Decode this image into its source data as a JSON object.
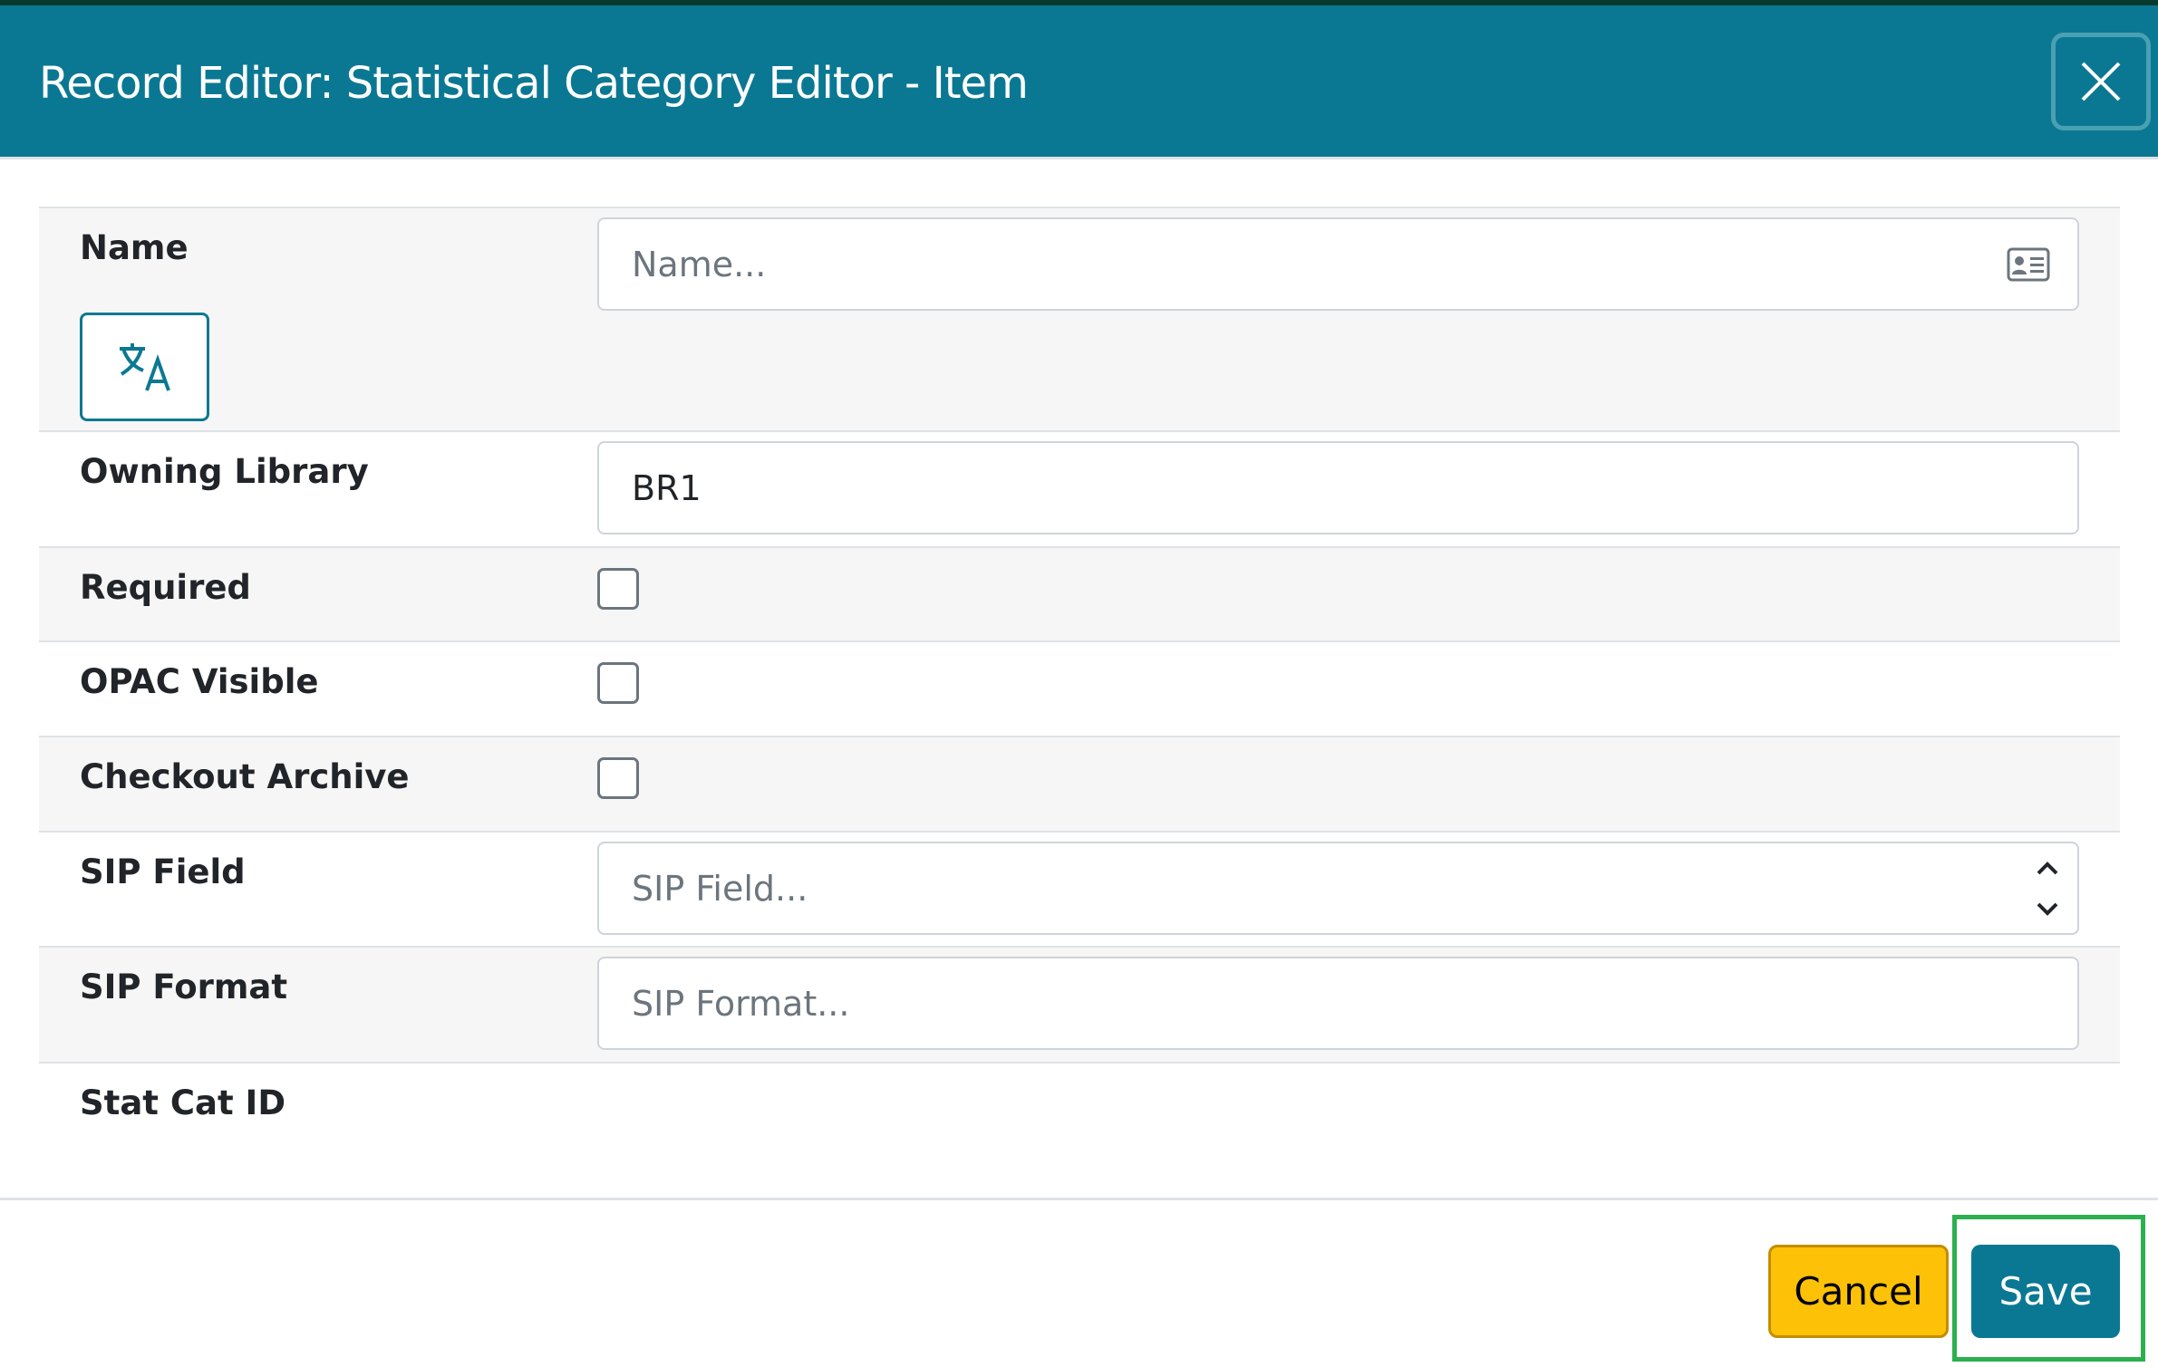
{
  "dialog": {
    "title": "Record Editor: Statistical Category Editor - Item"
  },
  "fields": {
    "name": {
      "label": "Name",
      "placeholder": "Name...",
      "value": ""
    },
    "owning_library": {
      "label": "Owning Library",
      "value": "BR1"
    },
    "required": {
      "label": "Required",
      "checked": false
    },
    "opac_visible": {
      "label": "OPAC Visible",
      "checked": false
    },
    "checkout_archive": {
      "label": "Checkout Archive",
      "checked": false
    },
    "sip_field": {
      "label": "SIP Field",
      "placeholder": "SIP Field..."
    },
    "sip_format": {
      "label": "SIP Format",
      "placeholder": "SIP Format..."
    },
    "stat_cat_id": {
      "label": "Stat Cat ID",
      "value": ""
    }
  },
  "footer": {
    "cancel_label": "Cancel",
    "save_label": "Save"
  },
  "colors": {
    "header": "#0b7893",
    "cancel": "#fdc107",
    "save": "#0b7893",
    "highlight": "#2bb04f"
  }
}
